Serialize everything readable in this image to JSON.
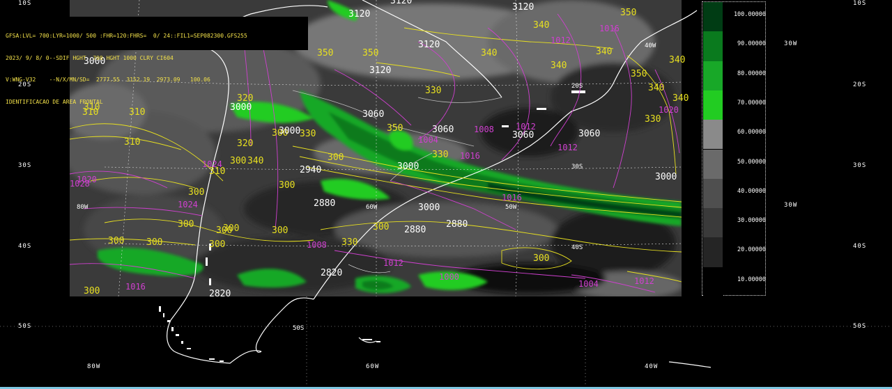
{
  "header": {
    "line1": "GFSA:LVL= 700:LYR=1000/ 500 :FHR=120:FHRS=  0/ 24::FIL1=SEP082300.GFS255",
    "line2": "2023/ 9/ 8/ 0--SDIF HGHT  700 HGHT 1000 CLRY CI604",
    "line3": "V:WNG-V32    --N/X/MN/SD=  2777.55  3152.19  2973.09   100.06",
    "line4": "IDENTIFICACAO DE AREA FRONTAL"
  },
  "legend": {
    "labels": [
      "100.00000",
      "90.00000",
      "80.00000",
      "70.00000",
      "60.00000",
      "50.00000",
      "40.00000",
      "30.00000",
      "20.00000",
      "10.00000"
    ],
    "colors": [
      "#003c14",
      "#0a7a1e",
      "#18a828",
      "#22cc22",
      "#8a8a8a",
      "#6a6a6a",
      "#4f4f4f",
      "#3a3a3a",
      "#252525",
      "#000000"
    ]
  },
  "axes": {
    "lat_left": [
      "10S",
      "20S",
      "30S",
      "40S",
      "50S"
    ],
    "lat_right": [
      "10S",
      "20S",
      "30S",
      "40S",
      "50S"
    ],
    "lon_bottom": [
      "80W",
      "60W",
      "40W"
    ],
    "lon_right": [
      "30W",
      "30W"
    ],
    "inner_lat": [
      "20S",
      "30S",
      "40S",
      "50S"
    ],
    "inner_lon": [
      "80W",
      "60W",
      "50W",
      "40W"
    ]
  },
  "contours": {
    "yellow_labels": [
      "340",
      "340",
      "350",
      "350",
      "340",
      "340",
      "350",
      "350",
      "340",
      "340",
      "330",
      "340",
      "330",
      "350",
      "310",
      "310",
      "310",
      "310",
      "320",
      "330",
      "340",
      "330",
      "300",
      "300",
      "300",
      "300",
      "300",
      "300",
      "300",
      "300",
      "300",
      "300",
      "300",
      "300",
      "300",
      "300",
      "310",
      "320",
      "330",
      "300"
    ],
    "magenta_labels": [
      "1012",
      "1016",
      "1020",
      "1008",
      "1004",
      "1012",
      "1012",
      "1016",
      "1020",
      "1028",
      "1024",
      "1016",
      "1008",
      "1012",
      "1016",
      "1004",
      "1012",
      "1000",
      "1024"
    ],
    "white_labels": [
      "3120",
      "3120",
      "3120",
      "3120",
      "3120",
      "3060",
      "3060",
      "3060",
      "3000",
      "3000",
      "3000",
      "3000",
      "2940",
      "2880",
      "2880",
      "2880",
      "2820",
      "2820",
      "3060",
      "3000",
      "3000"
    ]
  },
  "colors": {
    "yellow": "#e8e020",
    "magenta": "#d040d0",
    "white": "#ffffff",
    "header_text": "#f4e24a"
  }
}
